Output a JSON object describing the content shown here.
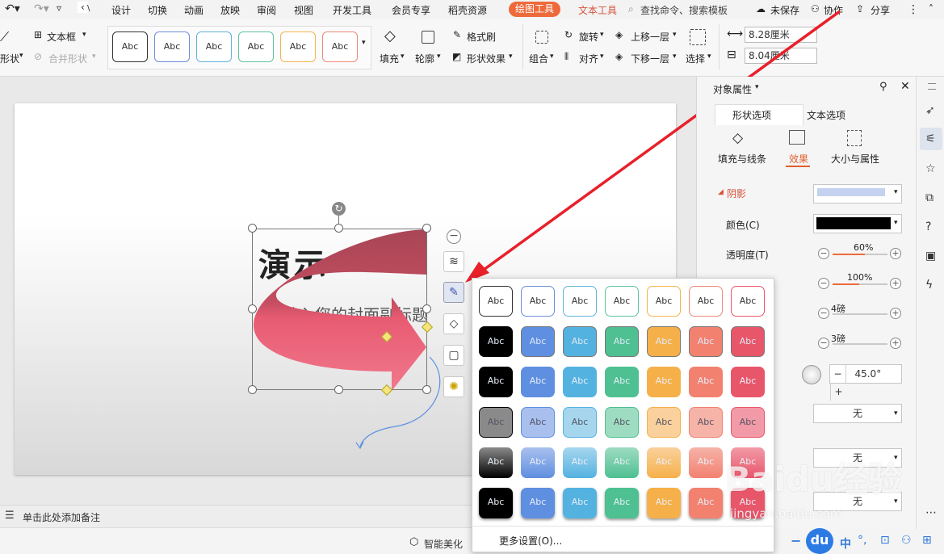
{
  "menubar": {
    "tabs": [
      "设计",
      "切换",
      "动画",
      "放映",
      "审阅",
      "视图",
      "开发工具",
      "会员专享",
      "稻壳资源"
    ],
    "active_tab": "绘图工具",
    "text_tab": "文本工具",
    "search_placeholder": "查找命令、搜索模板",
    "unsaved": "未保存",
    "collab": "协作",
    "share": "分享"
  },
  "ribbon": {
    "textbox": "文本框",
    "shape": "形状",
    "merge_shape": "合并形状",
    "style_sample": "Abc",
    "fill": "填充",
    "outline": "轮廓",
    "format_brush": "格式刷",
    "shape_effect": "形状效果",
    "group": "组合",
    "rotate": "旋转",
    "align": "对齐",
    "bring_forward": "上移一层",
    "send_backward": "下移一层",
    "select": "选择",
    "height": "8.28厘米",
    "width": "8.04厘米"
  },
  "slide": {
    "title_partial": "演示",
    "subtitle": "请输入您的封面副标题"
  },
  "notes": {
    "placeholder": "单击此处添加备注"
  },
  "status": {
    "smart_beautify": "智能美化"
  },
  "pane": {
    "title": "对象属性",
    "tabs": [
      "形状选项",
      "文本选项"
    ],
    "subtabs": [
      "填充与线条",
      "效果",
      "大小与属性"
    ],
    "section": "阴影",
    "color_label": "颜色(C)",
    "transparency_label": "透明度(T)",
    "transparency": "60%",
    "size": "100%",
    "blur": "4磅",
    "distance": "3磅",
    "angle": "45.0°",
    "none1": "无",
    "none2": "无",
    "none3": "无"
  },
  "popup": {
    "sample": "Abc",
    "more_settings": "更多设置(O)..."
  },
  "colors": {
    "accent": "#ee6a3b",
    "arrow_red": "#e8566a",
    "annotation_red": "#e8202a"
  },
  "watermark": {
    "text": "Baidu经验",
    "url": "jingyan.baidu.com"
  },
  "taskbar": {
    "ime": "中"
  }
}
